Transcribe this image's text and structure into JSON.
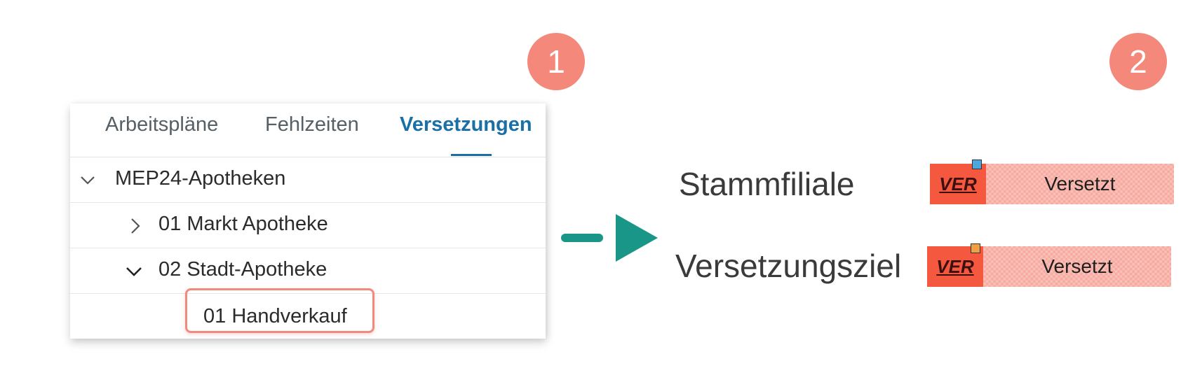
{
  "badges": {
    "step1": "1",
    "step2": "2"
  },
  "tabs": [
    {
      "label": "Arbeitspläne",
      "active": false
    },
    {
      "label": "Fehlzeiten",
      "active": false
    },
    {
      "label": "Versetzungen",
      "active": true
    }
  ],
  "tree": {
    "root": {
      "label": "MEP24-Apotheken",
      "expanded": true
    },
    "items": [
      {
        "label": "01 Markt Apotheke",
        "expanded": false
      },
      {
        "label": "02 Stadt-Apotheke",
        "expanded": true
      },
      {
        "label": "01 Handverkauf",
        "highlighted": true
      }
    ]
  },
  "legend": {
    "rows": [
      {
        "label": "Stammfiliale",
        "code": "VER",
        "status": "Versetzt",
        "marker_color": "#4aa7e0"
      },
      {
        "label": "Versetzungsziel",
        "code": "VER",
        "status": "Versetzt",
        "marker_color": "#f0a040"
      }
    ]
  },
  "colors": {
    "accent": "#1a6fa6",
    "badge": "#f4897b",
    "arrow": "#1a9688",
    "code_box": "#f4593f",
    "shift_bar": "#f7a99f"
  }
}
